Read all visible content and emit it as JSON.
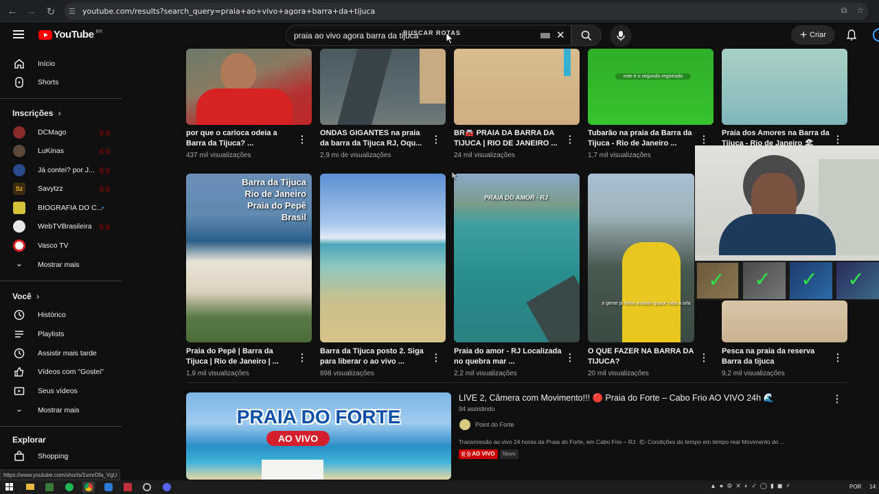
{
  "browser": {
    "url": "youtube.com/results?search_query=praia+ao+vivo+agora+barra+da+tijuca"
  },
  "header": {
    "logo_text": "YouTube",
    "logo_region": "BR",
    "search_value": "praia ao vivo agora barra da tijuca",
    "overlay_text": "BUSCAR ROTAS",
    "create_label": "Criar"
  },
  "sidebar": {
    "main": [
      {
        "label": "Início",
        "icon": "home-icon"
      },
      {
        "label": "Shorts",
        "icon": "shorts-icon"
      }
    ],
    "subs_title": "Inscrições",
    "subs": [
      {
        "label": "DCMago",
        "color": "#8a2b2b",
        "status": "live"
      },
      {
        "label": "LuKinas",
        "color": "#5b4a3a",
        "status": "live"
      },
      {
        "label": "Já contei? por J...",
        "color": "#2a4a8a",
        "status": "live"
      },
      {
        "label": "Savytzz",
        "color": "#c9a227",
        "status": "live"
      },
      {
        "label": "BIOGRAFIA DO C...",
        "color": "#d4c23a",
        "status": "new"
      },
      {
        "label": "WebTVBrasileira",
        "color": "#e8e8e8",
        "status": "live"
      },
      {
        "label": "Vasco TV",
        "color": "#d22",
        "status": "none"
      }
    ],
    "subs_more": "Mostrar mais",
    "you_title": "Você",
    "you": [
      {
        "label": "Histórico",
        "icon": "history-icon"
      },
      {
        "label": "Playlists",
        "icon": "playlists-icon"
      },
      {
        "label": "Assistir mais tarde",
        "icon": "clock-icon"
      },
      {
        "label": "Vídeos com \"Gostei\"",
        "icon": "thumbs-up-icon"
      },
      {
        "label": "Seus vídeos",
        "icon": "video-icon"
      }
    ],
    "you_more": "Mostrar mais",
    "explore_title": "Explorar",
    "explore": [
      {
        "label": "Shopping",
        "icon": "bag-icon"
      }
    ]
  },
  "row1": [
    {
      "title": "por que o carioca odeia a Barra da Tijuca? ...",
      "views": "437 mil visualizações"
    },
    {
      "title": "ONDAS GIGANTES na praia da barra da Tijuca RJ, Oqu...",
      "views": "2,9 mi de visualizações"
    },
    {
      "title": "BR🚘 PRAIA DA BARRA DA TIJUCA | RIO DE JANEIRO ...",
      "views": "24 mil visualizações"
    },
    {
      "title": "Tubarão na praia da Barra da Tijuca - Rio de Janeiro ...",
      "views": "1,7 mil visualizações",
      "thumb_text": "este é o segundo registrado"
    },
    {
      "title": "Praia dos Amores na Barra da Tijuca - Rio de Janeiro 🏖",
      "views": ""
    }
  ],
  "row2": [
    {
      "title": "Praia do Pepê | Barra da Tijuca | Rio de Janeiro | ...",
      "views": "1,9 mil visualizações",
      "thumb_lines": [
        "Barra da Tijuca",
        "Rio de Janeiro",
        "Praia do Pepê",
        "Brasil"
      ]
    },
    {
      "title": "Barra da Tijuca posto 2. Siga para liberar o ao vivo ...",
      "views": "898 visualizações"
    },
    {
      "title": "Praia do amor - RJ Localizada no quebra mar ...",
      "views": "2,2 mil visualizações",
      "thumb_text": "PRAIA DO AMOR - RJ"
    },
    {
      "title": "O QUE FAZER NA BARRA DA TIJUCA?",
      "views": "20 mil visualizações",
      "thumb_text": "a gente já tinha andado quase toda a orla"
    },
    {
      "title": "Pesca na praia da reserva Barra da tijuca",
      "views": "9,2 mil visualizações"
    }
  ],
  "live": {
    "title": "LIVE 2, Câmera com Movimento!!! 🔴 Praia do Forte – Cabo Frio AO VIVO 24h 🌊",
    "watching": "94 assistindo",
    "channel": "Point do Forte",
    "description": "Transmissão ao vivo 24 horas da Praia do Forte, em Cabo Frio – RJ. 🌤 Condições do tempo em tempo real Movimento do ...",
    "badge_live": "AO VIVO",
    "badge_new": "Novo",
    "thumb_title": "PRAIA DO FORTE",
    "thumb_live": "AO VIVO"
  },
  "status_bar_url": "https://www.youtube.com/shorts/1xmrDfa_VgU",
  "taskbar": {
    "lang": "POR",
    "time": "14:"
  }
}
